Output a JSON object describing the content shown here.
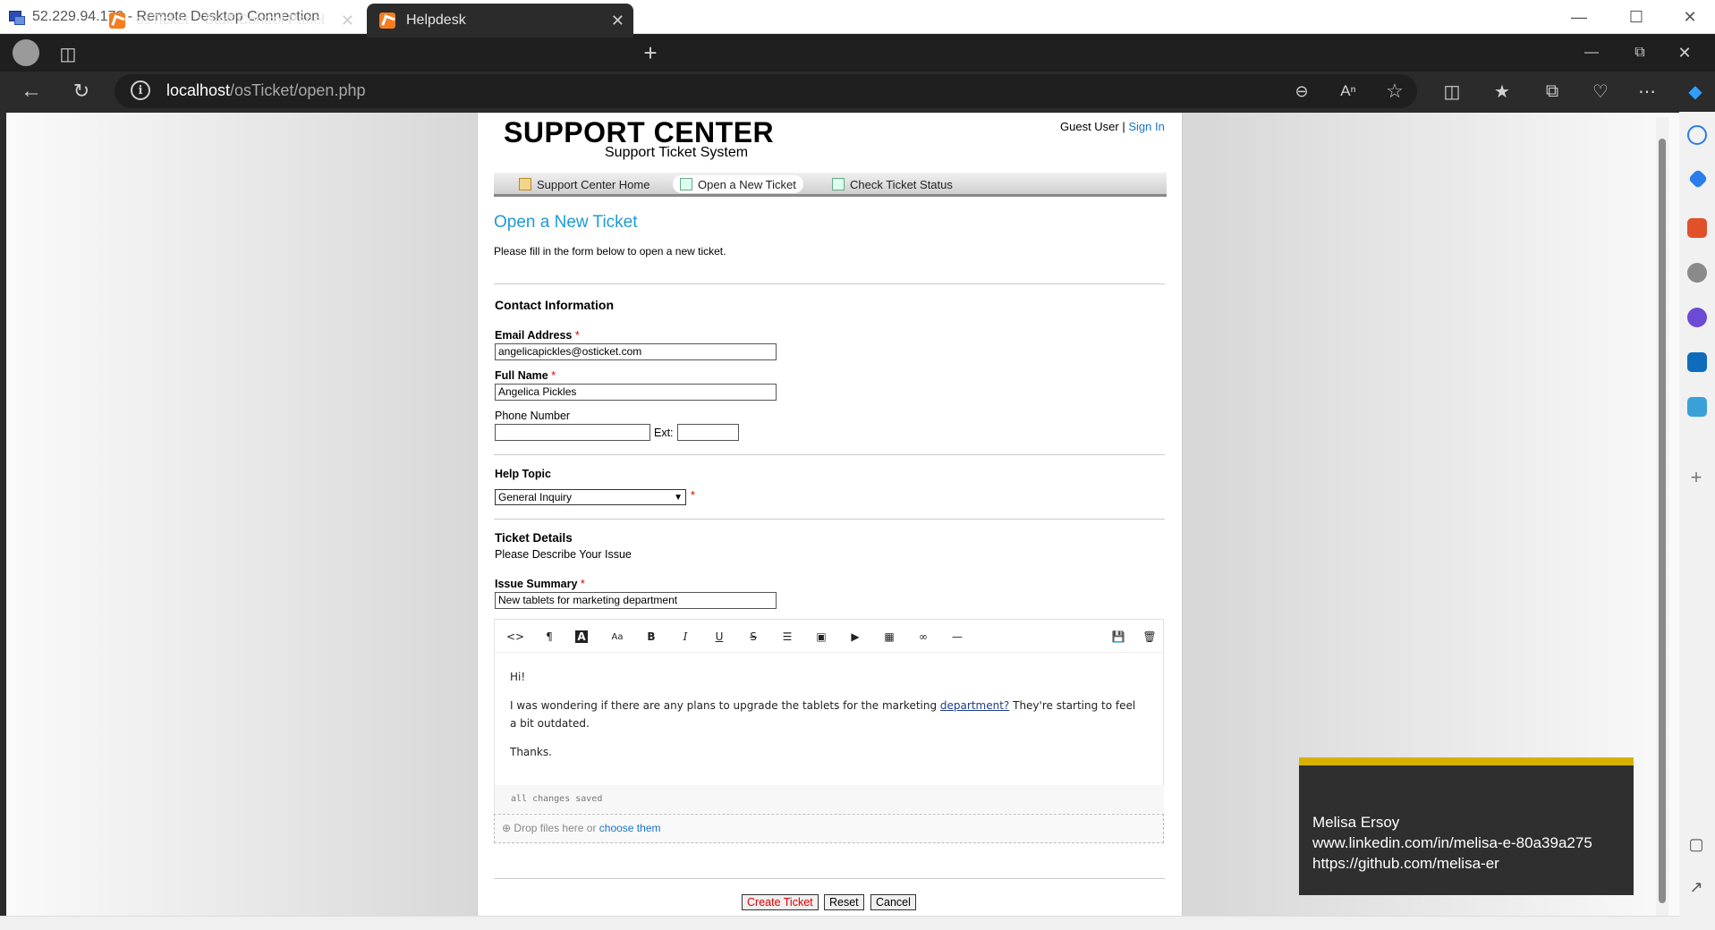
{
  "rdp": {
    "title": "52.229.94.172 - Remote Desktop Connection"
  },
  "browser": {
    "tabs": [
      {
        "label": "osTicket :: Staff Control Panel"
      },
      {
        "label": "Helpdesk"
      }
    ],
    "url_host": "localhost",
    "url_path": "/osTicket/open.php"
  },
  "header": {
    "logo_title": "SUPPORT CENTER",
    "logo_subtitle": "Support Ticket System",
    "guest_label": "Guest User |",
    "sign_in": "Sign In"
  },
  "nav": {
    "items": [
      {
        "label": "Support Center Home"
      },
      {
        "label": "Open a New Ticket"
      },
      {
        "label": "Check Ticket Status"
      }
    ]
  },
  "form": {
    "title": "Open a New Ticket",
    "intro": "Please fill in the form below to open a new ticket.",
    "contact_heading": "Contact Information",
    "email_label": "Email Address",
    "email_value": "angelicapickles@osticket.com",
    "name_label": "Full Name",
    "name_value": "Angelica Pickles",
    "phone_label": "Phone Number",
    "phone_value": "",
    "ext_label": "Ext:",
    "ext_value": "",
    "help_topic_label": "Help Topic",
    "help_topic_value": "General Inquiry",
    "details_heading": "Ticket Details",
    "details_sub": "Please Describe Your Issue",
    "summary_label": "Issue Summary",
    "summary_value": "New tablets for marketing department",
    "required_mark": "*"
  },
  "editor": {
    "line1": "Hi!",
    "line2a": "I was wondering if there are any plans to upgrade the tablets for the marketing ",
    "line2_link": "department?",
    "line2b": " They're starting to feel a bit outdated.",
    "line3": "Thanks.",
    "status": "all changes saved",
    "drop_text": "Drop files here or ",
    "drop_choose": "choose them"
  },
  "buttons": {
    "create": "Create Ticket",
    "reset": "Reset",
    "cancel": "Cancel"
  },
  "card": {
    "name": "Melisa Ersoy",
    "linkedin": "www.linkedin.com/in/melisa-e-80a39a275",
    "github": "https://github.com/melisa-er"
  }
}
